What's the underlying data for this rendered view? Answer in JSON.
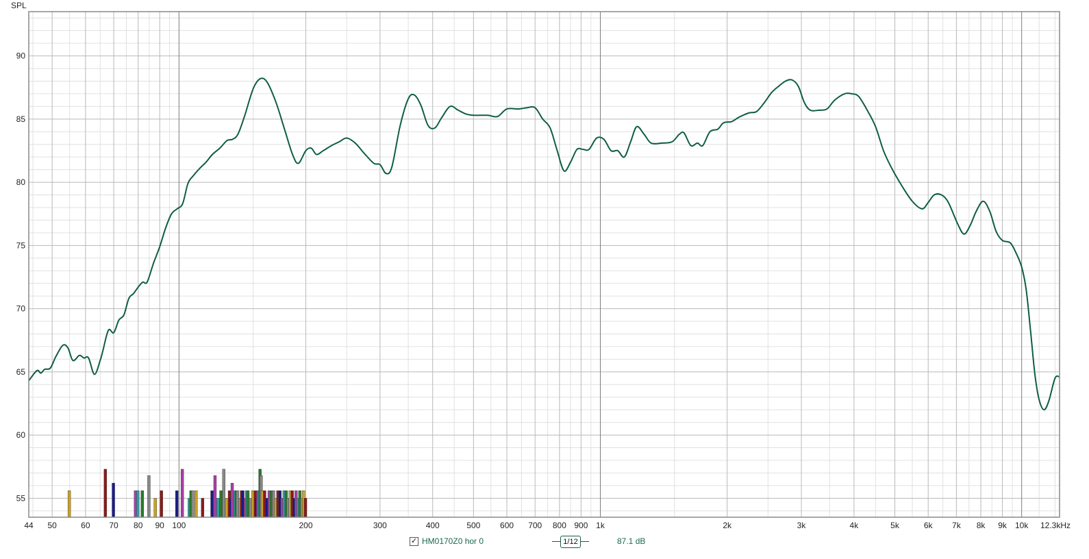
{
  "colors": {
    "curve": "#0d5e3e",
    "grid_major": "#b8b8b8",
    "grid_minor": "#e0e0e0",
    "grid_decade": "#7a7a7a",
    "frame": "#888888"
  },
  "legend": {
    "checked_glyph": "✓",
    "measurement_name": "HM0170Z0 hor 0",
    "smoothing": "1/12",
    "value_readout": "87.1 dB"
  },
  "chart_data": {
    "type": "line",
    "title": "",
    "ylabel": "SPL",
    "xlabel": "",
    "x_scale": "log",
    "xlim": [
      44,
      12300
    ],
    "ylim": [
      53.5,
      93.5
    ],
    "grid": true,
    "x_tick_values": [
      44,
      50,
      60,
      70,
      80,
      90,
      100,
      200,
      300,
      400,
      500,
      600,
      700,
      800,
      900,
      1000,
      2000,
      3000,
      4000,
      5000,
      6000,
      7000,
      8000,
      9000,
      10000,
      12300
    ],
    "x_tick_labels": [
      "44",
      "50",
      "60",
      "70",
      "80",
      "90",
      "100",
      "200",
      "300",
      "400",
      "500",
      "600",
      "700",
      "800",
      "900",
      "1k",
      "2k",
      "3k",
      "4k",
      "5k",
      "6k",
      "7k",
      "8k",
      "9k",
      "10k",
      "12.3kHz"
    ],
    "y_ticks": [
      55,
      60,
      65,
      70,
      75,
      80,
      85,
      90
    ],
    "series": [
      {
        "name": "HM0170Z0 hor 0",
        "color": "#0d5e3e",
        "points": [
          [
            44,
            64.3
          ],
          [
            46,
            65.1
          ],
          [
            47,
            64.9
          ],
          [
            48,
            65.2
          ],
          [
            49.5,
            65.3
          ],
          [
            51,
            66.2
          ],
          [
            53,
            67.1
          ],
          [
            54.5,
            66.9
          ],
          [
            56,
            65.9
          ],
          [
            58,
            66.3
          ],
          [
            59.5,
            66.1
          ],
          [
            61,
            66.1
          ],
          [
            63,
            64.8
          ],
          [
            65,
            65.9
          ],
          [
            66,
            66.7
          ],
          [
            68,
            68.3
          ],
          [
            70,
            68.1
          ],
          [
            72,
            69.1
          ],
          [
            74,
            69.5
          ],
          [
            76,
            70.8
          ],
          [
            78,
            71.2
          ],
          [
            80,
            71.7
          ],
          [
            82,
            72.1
          ],
          [
            84,
            72.1
          ],
          [
            87,
            73.6
          ],
          [
            90,
            74.9
          ],
          [
            93,
            76.4
          ],
          [
            96,
            77.5
          ],
          [
            99,
            77.9
          ],
          [
            102,
            78.3
          ],
          [
            105,
            79.9
          ],
          [
            108,
            80.5
          ],
          [
            112,
            81.1
          ],
          [
            116,
            81.6
          ],
          [
            120,
            82.2
          ],
          [
            125,
            82.7
          ],
          [
            130,
            83.3
          ],
          [
            134,
            83.4
          ],
          [
            138,
            83.8
          ],
          [
            143,
            85.2
          ],
          [
            150,
            87.4
          ],
          [
            156,
            88.2
          ],
          [
            162,
            87.9
          ],
          [
            170,
            86.3
          ],
          [
            178,
            84.2
          ],
          [
            186,
            82.2
          ],
          [
            192,
            81.5
          ],
          [
            200,
            82.5
          ],
          [
            206,
            82.7
          ],
          [
            212,
            82.2
          ],
          [
            220,
            82.5
          ],
          [
            230,
            82.9
          ],
          [
            240,
            83.2
          ],
          [
            250,
            83.5
          ],
          [
            262,
            83.1
          ],
          [
            275,
            82.3
          ],
          [
            290,
            81.5
          ],
          [
            300,
            81.4
          ],
          [
            310,
            80.7
          ],
          [
            320,
            81.2
          ],
          [
            335,
            84.5
          ],
          [
            350,
            86.6
          ],
          [
            362,
            86.9
          ],
          [
            375,
            86.1
          ],
          [
            390,
            84.5
          ],
          [
            405,
            84.3
          ],
          [
            420,
            85.1
          ],
          [
            440,
            86.0
          ],
          [
            460,
            85.7
          ],
          [
            480,
            85.4
          ],
          [
            500,
            85.3
          ],
          [
            540,
            85.3
          ],
          [
            570,
            85.2
          ],
          [
            600,
            85.8
          ],
          [
            640,
            85.8
          ],
          [
            670,
            85.9
          ],
          [
            700,
            85.9
          ],
          [
            730,
            85.0
          ],
          [
            760,
            84.3
          ],
          [
            790,
            82.5
          ],
          [
            820,
            80.9
          ],
          [
            850,
            81.6
          ],
          [
            880,
            82.6
          ],
          [
            910,
            82.6
          ],
          [
            940,
            82.6
          ],
          [
            980,
            83.5
          ],
          [
            1020,
            83.4
          ],
          [
            1060,
            82.5
          ],
          [
            1100,
            82.5
          ],
          [
            1140,
            82.0
          ],
          [
            1180,
            83.2
          ],
          [
            1220,
            84.4
          ],
          [
            1270,
            83.8
          ],
          [
            1320,
            83.1
          ],
          [
            1400,
            83.1
          ],
          [
            1480,
            83.2
          ],
          [
            1540,
            83.8
          ],
          [
            1580,
            83.9
          ],
          [
            1640,
            82.9
          ],
          [
            1700,
            83.1
          ],
          [
            1750,
            82.9
          ],
          [
            1820,
            84.0
          ],
          [
            1900,
            84.2
          ],
          [
            1960,
            84.7
          ],
          [
            2050,
            84.8
          ],
          [
            2120,
            85.1
          ],
          [
            2180,
            85.3
          ],
          [
            2260,
            85.5
          ],
          [
            2350,
            85.6
          ],
          [
            2450,
            86.3
          ],
          [
            2550,
            87.1
          ],
          [
            2650,
            87.6
          ],
          [
            2750,
            88.0
          ],
          [
            2850,
            88.1
          ],
          [
            2950,
            87.6
          ],
          [
            3050,
            86.3
          ],
          [
            3150,
            85.7
          ],
          [
            3300,
            85.7
          ],
          [
            3450,
            85.8
          ],
          [
            3600,
            86.5
          ],
          [
            3800,
            87.0
          ],
          [
            3950,
            87.0
          ],
          [
            4100,
            86.8
          ],
          [
            4300,
            85.7
          ],
          [
            4500,
            84.4
          ],
          [
            4700,
            82.5
          ],
          [
            4900,
            81.2
          ],
          [
            5200,
            79.7
          ],
          [
            5500,
            78.5
          ],
          [
            5800,
            77.9
          ],
          [
            6000,
            78.4
          ],
          [
            6200,
            79.0
          ],
          [
            6450,
            79.0
          ],
          [
            6700,
            78.4
          ],
          [
            7050,
            76.7
          ],
          [
            7300,
            75.9
          ],
          [
            7550,
            76.6
          ],
          [
            7800,
            77.7
          ],
          [
            8100,
            78.5
          ],
          [
            8400,
            77.7
          ],
          [
            8700,
            76.1
          ],
          [
            9000,
            75.4
          ],
          [
            9400,
            75.2
          ],
          [
            9700,
            74.4
          ],
          [
            10000,
            73.3
          ],
          [
            10250,
            71.5
          ],
          [
            10500,
            68.2
          ],
          [
            10750,
            64.8
          ],
          [
            11000,
            62.8
          ],
          [
            11300,
            62.0
          ],
          [
            11600,
            62.7
          ],
          [
            12000,
            64.5
          ],
          [
            12300,
            64.6
          ]
        ]
      }
    ],
    "bars": {
      "note_color_cycle": [
        "#c9a227",
        "#8b1a1a",
        "#1a1a8b",
        "#a83ea8",
        "#2f9e9e",
        "#2a7a2a",
        "#888888"
      ],
      "x": [
        55,
        67,
        70,
        79,
        80,
        82,
        85,
        88,
        91,
        99,
        102,
        106,
        107,
        108,
        110,
        114,
        120,
        122,
        124,
        126,
        128,
        130,
        132,
        133,
        134,
        136,
        137,
        138,
        140,
        141,
        142,
        144,
        145,
        146,
        148,
        150,
        152,
        153,
        154,
        155,
        156,
        157,
        158,
        160,
        162,
        164,
        165,
        166,
        168,
        170,
        172,
        174,
        176,
        178,
        180,
        182,
        184,
        186,
        188,
        190,
        192,
        194,
        196,
        198,
        200
      ],
      "values": [
        55.6,
        57.3,
        56.2,
        55.6,
        55.6,
        55.6,
        56.8,
        55.0,
        55.6,
        55.6,
        57.3,
        55.0,
        55.6,
        55.6,
        55.6,
        55.0,
        55.6,
        56.8,
        55.0,
        55.6,
        57.3,
        55.0,
        55.6,
        55.0,
        56.2,
        55.6,
        55.6,
        55.6,
        55.0,
        55.6,
        55.6,
        55.0,
        55.6,
        55.6,
        55.0,
        55.6,
        55.6,
        55.0,
        55.6,
        55.6,
        57.3,
        56.8,
        55.6,
        55.6,
        55.0,
        55.6,
        55.0,
        55.6,
        55.6,
        55.0,
        55.6,
        55.6,
        55.0,
        55.6,
        55.6,
        55.0,
        55.6,
        55.6,
        55.0,
        55.6,
        55.0,
        55.6,
        55.0,
        55.6,
        55.0
      ]
    }
  }
}
